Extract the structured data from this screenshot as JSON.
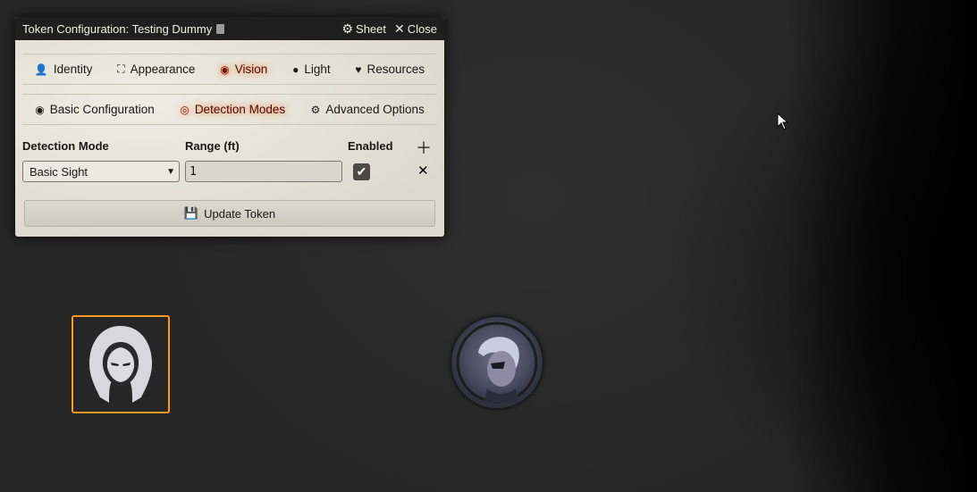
{
  "window": {
    "title": "Token Configuration: Testing Dummy",
    "sheet_label": "Sheet",
    "close_label": "Close"
  },
  "tabs": [
    {
      "label": "Identity",
      "icon": "user-icon"
    },
    {
      "label": "Appearance",
      "icon": "expand-icon"
    },
    {
      "label": "Vision",
      "icon": "eye-icon",
      "active": true
    },
    {
      "label": "Light",
      "icon": "lightbulb-icon"
    },
    {
      "label": "Resources",
      "icon": "heart-icon"
    }
  ],
  "subtabs": [
    {
      "label": "Basic Configuration",
      "icon": "eye-icon"
    },
    {
      "label": "Detection Modes",
      "icon": "detection-icon",
      "active": true
    },
    {
      "label": "Advanced Options",
      "icon": "cogs-icon"
    }
  ],
  "detection": {
    "col_mode": "Detection Mode",
    "col_range": "Range (ft)",
    "col_enabled": "Enabled",
    "rows": [
      {
        "mode": "Basic Sight",
        "range": "1",
        "enabled": true
      }
    ]
  },
  "update_button": "Update Token",
  "colors": {
    "active_glow": "#ff6400",
    "token_selected_border": "#ff9a1f"
  }
}
